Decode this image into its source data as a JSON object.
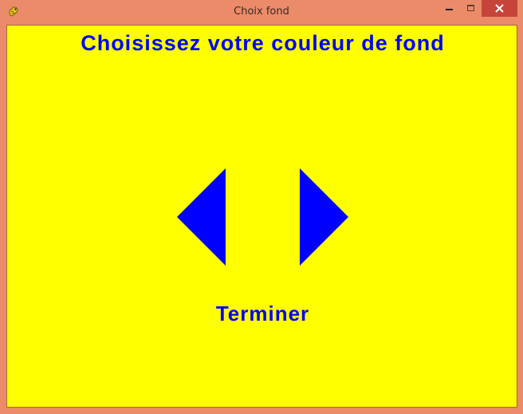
{
  "window": {
    "title": "Choix fond",
    "app_icon": "pygame-snake-icon",
    "controls": {
      "minimize_icon": "minimize-icon",
      "maximize_icon": "maximize-icon",
      "close_icon": "close-icon"
    }
  },
  "content": {
    "heading": "Choisissez votre couleur de fond",
    "prev_icon": "triangle-left-icon",
    "next_icon": "triangle-right-icon",
    "finish_label": "Terminer",
    "background_color": "#ffff00",
    "accent_color": "#0000ff"
  },
  "colors": {
    "titlebar": "#ec8b69",
    "close_button": "#c7443a"
  }
}
